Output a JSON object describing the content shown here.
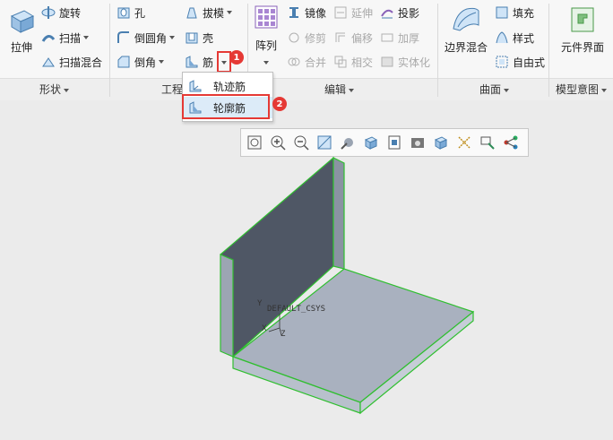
{
  "ribbon": {
    "shape": {
      "extrude": "拉伸",
      "revolve": "旋转",
      "sweep": "扫描",
      "swept_blend": "扫描混合",
      "group": "形状"
    },
    "engineering": {
      "hole": "孔",
      "draft": "拔模",
      "round": "倒圆角",
      "shell": "壳",
      "chamfer": "倒角",
      "rib": "筋",
      "group": "工程"
    },
    "editing": {
      "pattern": "阵列",
      "mirror": "镜像",
      "extend": "延伸",
      "project": "投影",
      "trim": "修剪",
      "offset": "偏移",
      "thicken": "加厚",
      "merge": "合并",
      "intersect": "相交",
      "solidify": "实体化",
      "group": "编辑"
    },
    "surfaces": {
      "boundary_blend": "边界混合",
      "fill": "填充",
      "style": "样式",
      "freestyle": "自由式",
      "group": "曲面"
    },
    "model_intent": {
      "component_interface": "元件界面",
      "group": "模型意图"
    }
  },
  "rib_menu": {
    "items": [
      "轨迹筋",
      "轮廓筋"
    ],
    "highlighted": "轮廓筋"
  },
  "callouts": [
    "1",
    "2"
  ],
  "model": {
    "csys_label": "DEFAULT_CSYS",
    "axes": [
      "Y",
      "X",
      "Z"
    ]
  },
  "colors": {
    "accent_red": "#e53935",
    "model_face": "#a9b1bf",
    "model_edge": "#2fbf2f",
    "highlight": "#dcebf8"
  }
}
